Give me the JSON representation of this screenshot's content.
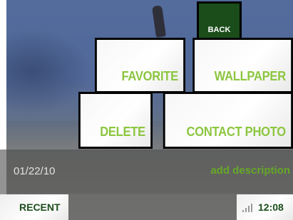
{
  "buttons": {
    "back": "BACK",
    "favorite": "FAVORITE",
    "wallpaper": "WALLPAPER",
    "delete": "DELETE",
    "contact_photo": "CONTACT PHOTO"
  },
  "photo_info": {
    "date": "01/22/10",
    "add_description": "add description"
  },
  "taskbar": {
    "recent": "RECENT",
    "time": "12:08",
    "signal_icon": "signal-bars-icon"
  },
  "colors": {
    "accent_green": "#8cc63f",
    "dark_green": "#1b4d1b",
    "tile_border": "#000000"
  }
}
